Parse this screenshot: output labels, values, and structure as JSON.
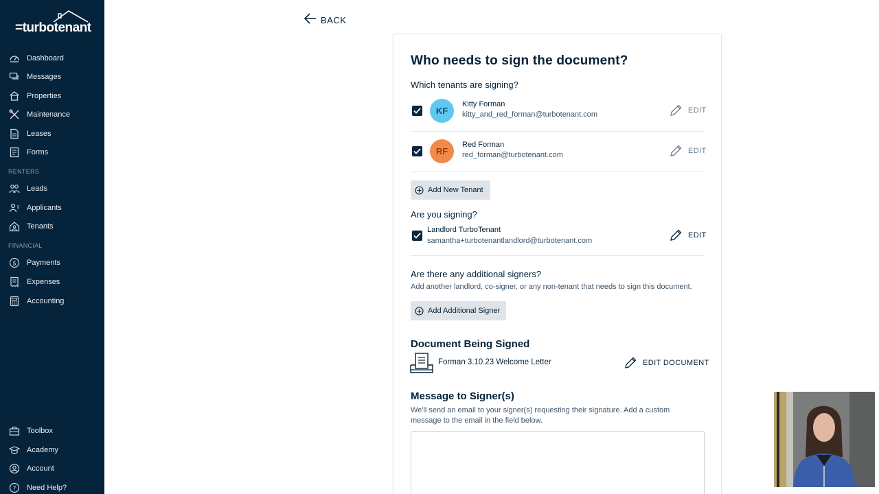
{
  "brand": {
    "logo_text": "=turbotenant"
  },
  "sidebar": {
    "items": [
      {
        "label": "Dashboard",
        "icon": "speedometer-icon"
      },
      {
        "label": "Messages",
        "icon": "chat-icon"
      },
      {
        "label": "Properties",
        "icon": "building-icon"
      },
      {
        "label": "Maintenance",
        "icon": "tools-icon"
      },
      {
        "label": "Leases",
        "icon": "document-icon"
      },
      {
        "label": "Forms",
        "icon": "form-icon"
      }
    ],
    "renters_section": "RENTERS",
    "renters_items": [
      {
        "label": "Leads",
        "icon": "people-icon"
      },
      {
        "label": "Applicants",
        "icon": "applicant-icon"
      },
      {
        "label": "Tenants",
        "icon": "house-person-icon"
      }
    ],
    "financial_section": "FINANCIAL",
    "financial_items": [
      {
        "label": "Payments",
        "icon": "dollar-icon"
      },
      {
        "label": "Expenses",
        "icon": "receipt-icon"
      },
      {
        "label": "Accounting",
        "icon": "calculator-icon"
      }
    ],
    "bottom_items": [
      {
        "label": "Toolbox",
        "icon": "toolbox-icon"
      },
      {
        "label": "Academy",
        "icon": "graduation-cap-icon"
      },
      {
        "label": "Account",
        "icon": "account-icon"
      },
      {
        "label": "Need Help?",
        "icon": "help-icon"
      }
    ]
  },
  "back_label": "BACK",
  "form": {
    "title": "Who needs to sign the document?",
    "tenants_question": "Which tenants are signing?",
    "tenants": [
      {
        "initials": "KF",
        "name": "Kitty Forman",
        "email": "kitty_and_red_forman@turbotenant.com",
        "checked": true,
        "avatar_color": "#5ec8ef",
        "initials_color": "#1a4f76"
      },
      {
        "initials": "RF",
        "name": "Red Forman",
        "email": "red_forman@turbotenant.com",
        "checked": true,
        "avatar_color": "#f08a4b",
        "initials_color": "#9a3b12"
      }
    ],
    "edit_label": "EDIT",
    "add_tenant_label": "Add New Tenant",
    "you_signing_question": "Are you signing?",
    "landlord": {
      "name": "Landlord TurboTenant",
      "email": "samantha+turbotenantlandlord@turbotenant.com",
      "checked": true
    },
    "additional_question": "Are there any additional signers?",
    "additional_desc": "Add another landlord, co-signer, or any non-tenant that needs to sign this document.",
    "add_signer_label": "Add Additional Signer",
    "document_heading": "Document Being Signed",
    "document_name": "Forman 3.10.23 Welcome Letter",
    "edit_document_label": "EDIT DOCUMENT",
    "message_heading": "Message to Signer(s)",
    "message_desc": "We'll send an email to your signer(s) requesting their signature. Add a custom message to the email in the field below.",
    "message_value": ""
  }
}
